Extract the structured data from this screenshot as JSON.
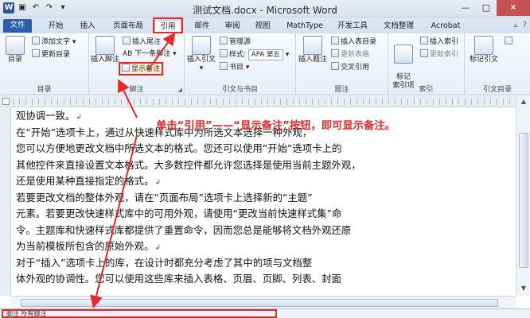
{
  "titlebar": {
    "title": "测试文档.docx - Microsoft Word",
    "app_icon": "W",
    "qat_icons": [
      "word-logo-icon",
      "save-icon",
      "undo-icon",
      "redo-icon",
      "customize-icon"
    ],
    "minimize": "—",
    "maximize": "□",
    "close": "✕"
  },
  "tabs": [
    {
      "label": "文件"
    },
    {
      "label": "开始"
    },
    {
      "label": "插入"
    },
    {
      "label": "页面布局"
    },
    {
      "label": "引用"
    },
    {
      "label": "邮件"
    },
    {
      "label": "审阅"
    },
    {
      "label": "视图"
    },
    {
      "label": "MathType"
    },
    {
      "label": "开发工具"
    },
    {
      "label": "文档整理"
    },
    {
      "label": "Acrobat"
    }
  ],
  "ribbon": {
    "toc": {
      "toc_button": "目录",
      "add_text": "添加文字",
      "update_toc": "更新目录",
      "group": "目录"
    },
    "footnotes": {
      "insert_footnote": "插入脚注",
      "insert_endnote": "插入尾注",
      "next_footnote": "AB 下一条脚注",
      "show_notes": "显示备注",
      "group": "脚注"
    },
    "citations": {
      "insert_citation": "插入引文",
      "manage_sources": "管理源",
      "style_label": "样式:",
      "style_value": "APA 第五",
      "bibliography": "书目",
      "group": "引文与书目"
    },
    "captions": {
      "insert_caption": "插入题注",
      "insert_table_of_figures": "插入表目录",
      "update_table": "更新表格",
      "cross_reference": "交叉引用",
      "group": "题注"
    },
    "index": {
      "mark_entry": "标记\n索引项",
      "insert_index": "插入索引",
      "update_index": "更新索引",
      "group": "索引"
    },
    "toa": {
      "mark_citation": "标记引文",
      "group": "引文目录"
    }
  },
  "annotation": "单击“引用”——“显示备注”按钮，即可显示备注。",
  "document": {
    "lines": [
      "观协调一致。",
      "    在“开始”选项卡上，通过从快速样式库中为所选文本选择一种外观，",
      "您可以方便地更改文档中所选文本的格式。您还可以使用“开始”选项卡上的",
      "其他控件来直接设置文本格式。大多数控件都允许您选择是使用当前主题外观，",
      "还是使用某种直接指定的格式。",
      "    若要更改文档的整体外观，请在“页面布局”选项卡上选择新的“主题”",
      "元素。若要更改快速样式库中的可用外观，请使用“更改当前快速样式集”命",
      "令。主题库和快速样式库都提供了重置命令，因而您总是能够将文档外观还原",
      "为当前模板所包含的原始外观。",
      "    对于“插入”选项卡上的库，在设计时都充分考虑了其中的项与文档整",
      "体外观的协调性。您可以使用这些库来插入表格、页眉、页脚、列表、封面"
    ],
    "paragraph_mark": "↲"
  },
  "notes_pane": {
    "label": "脚注  所有脚注"
  }
}
